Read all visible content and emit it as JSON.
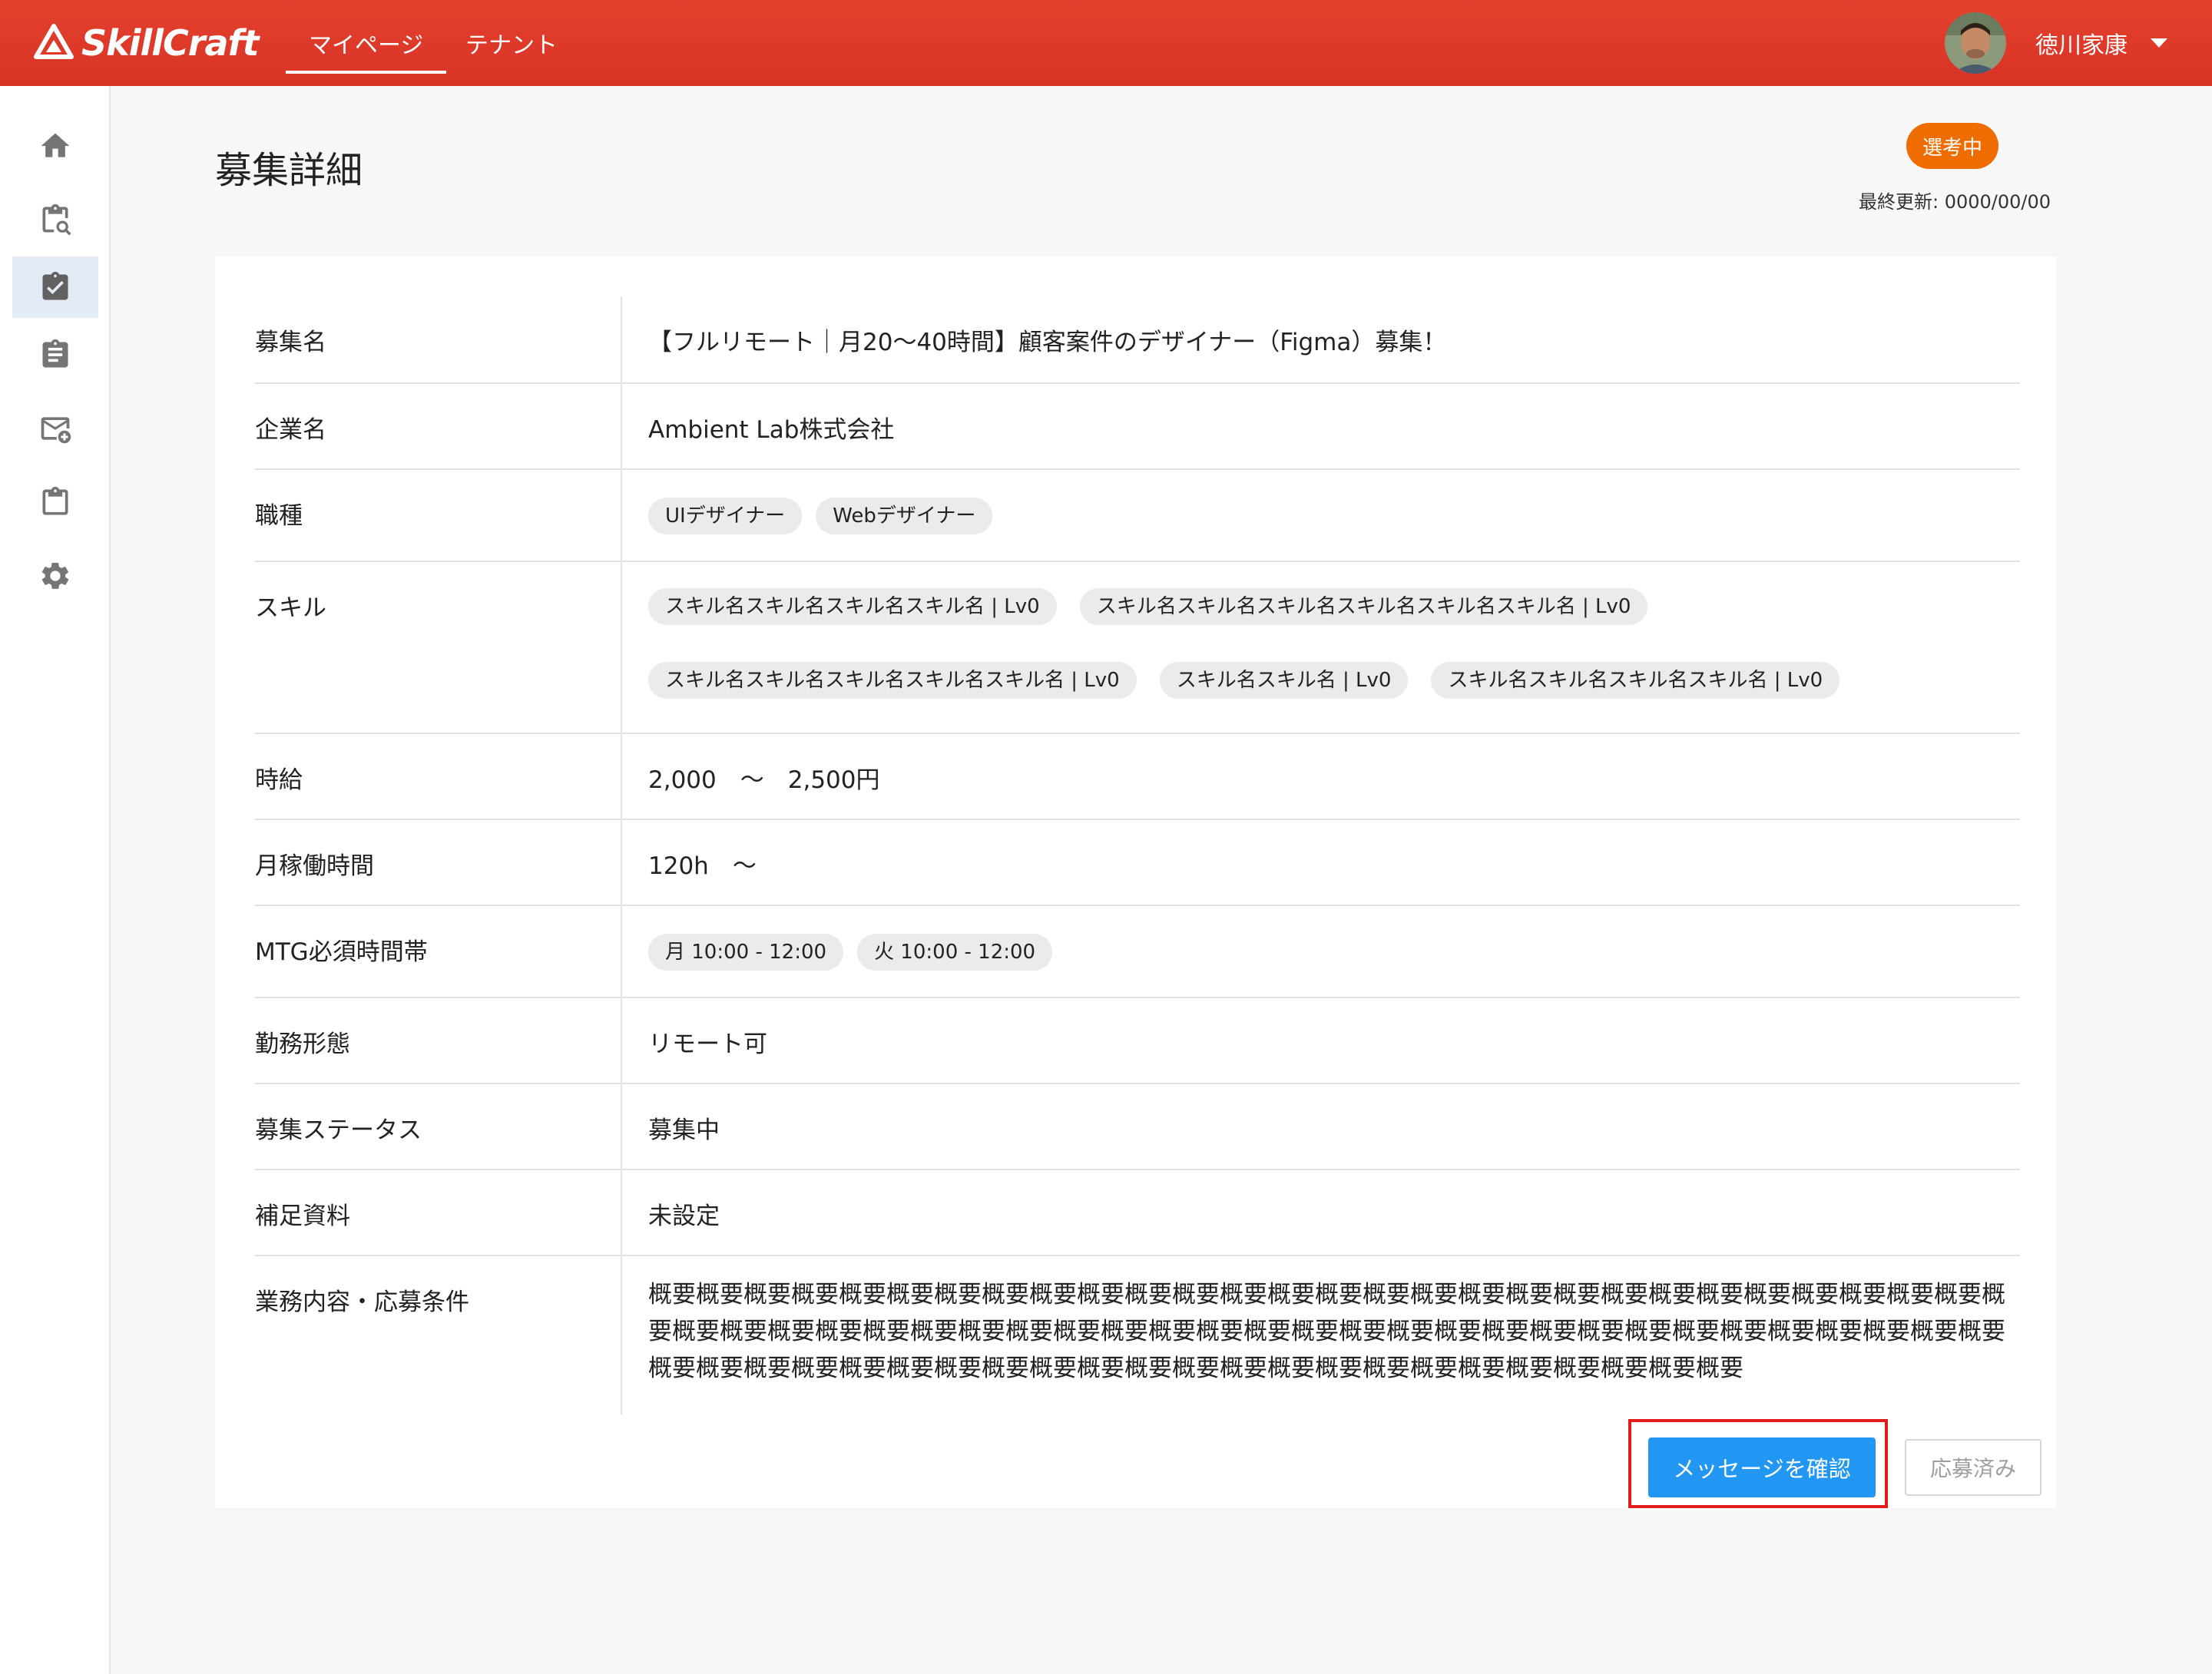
{
  "header": {
    "app_name": "SkillCraft",
    "tabs": [
      {
        "label": "マイページ",
        "active": true
      },
      {
        "label": "テナント",
        "active": false
      }
    ],
    "user_name": "徳川家康"
  },
  "sidebar": {
    "items": [
      {
        "icon": "home-icon",
        "active": false
      },
      {
        "icon": "job-search-icon",
        "active": false
      },
      {
        "icon": "assignment-check-icon",
        "active": true
      },
      {
        "icon": "assignment-icon",
        "active": false
      },
      {
        "icon": "mail-add-icon",
        "active": false
      },
      {
        "icon": "clipboard-icon",
        "active": false
      },
      {
        "icon": "gear-icon",
        "active": false
      }
    ]
  },
  "page": {
    "title": "募集詳細",
    "status_badge": "選考中",
    "last_updated": "最終更新: 0000/00/00"
  },
  "details": {
    "recruit_name": {
      "label": "募集名",
      "value": "【フルリモート｜月20〜40時間】顧客案件のデザイナー（Figma）募集！"
    },
    "company": {
      "label": "企業名",
      "value": "Ambient Lab株式会社"
    },
    "job_type": {
      "label": "職種",
      "chips": [
        "UIデザイナー",
        "Webデザイナー"
      ]
    },
    "skills": {
      "label": "スキル",
      "chips": [
        "スキル名スキル名スキル名スキル名 | Lv0",
        "スキル名スキル名スキル名スキル名スキル名スキル名 | Lv0",
        "スキル名スキル名スキル名スキル名スキル名 | Lv0",
        "スキル名スキル名 | Lv0",
        "スキル名スキル名スキル名スキル名 | Lv0"
      ]
    },
    "hourly_wage": {
      "label": "時給",
      "value": "2,000　～　2,500円"
    },
    "monthly_hours": {
      "label": "月稼働時間",
      "value": "120h　～"
    },
    "mtg_time": {
      "label": "MTG必須時間帯",
      "chips": [
        "月 10:00 - 12:00",
        "火 10:00 - 12:00"
      ]
    },
    "work_style": {
      "label": "勤務形態",
      "value": "リモート可"
    },
    "recruit_status": {
      "label": "募集ステータス",
      "value": "募集中"
    },
    "materials": {
      "label": "補足資料",
      "value": "未設定"
    },
    "description": {
      "label": "業務内容・応募条件",
      "value": "概要概要概要概要概要概要概要概要概要概要概要概要概要概要概要概要概要概要概要概要概要概要概要概要概要概要概要概要概要概要概要概要概要概要概要概要概要概要概要概要概要概要概要概要概要概要概要概要概要概要概要概要概要概要概要概要概要概要概要概要概要概要概要概要概要概要概要概要概要概要概要概要概要概要概要概要概要概要概要概要"
    }
  },
  "actions": {
    "check_message": "メッセージを確認",
    "applied": "応募済み"
  },
  "colors": {
    "header": "#e13d2c",
    "accent": "#2196f3",
    "status_badge": "#ef6c00",
    "highlight": "#e21b1b"
  }
}
